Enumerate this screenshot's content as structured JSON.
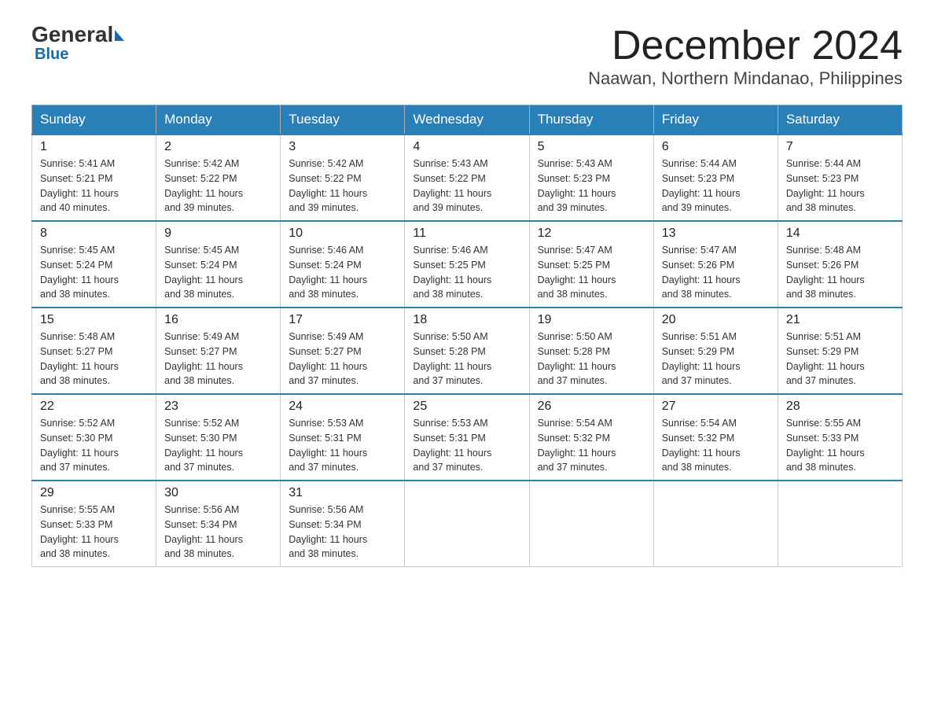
{
  "header": {
    "logo_general": "General",
    "logo_blue": "Blue",
    "month_title": "December 2024",
    "location": "Naawan, Northern Mindanao, Philippines"
  },
  "weekdays": [
    "Sunday",
    "Monday",
    "Tuesday",
    "Wednesday",
    "Thursday",
    "Friday",
    "Saturday"
  ],
  "weeks": [
    [
      {
        "day": "1",
        "sunrise": "5:41 AM",
        "sunset": "5:21 PM",
        "daylight": "11 hours and 40 minutes."
      },
      {
        "day": "2",
        "sunrise": "5:42 AM",
        "sunset": "5:22 PM",
        "daylight": "11 hours and 39 minutes."
      },
      {
        "day": "3",
        "sunrise": "5:42 AM",
        "sunset": "5:22 PM",
        "daylight": "11 hours and 39 minutes."
      },
      {
        "day": "4",
        "sunrise": "5:43 AM",
        "sunset": "5:22 PM",
        "daylight": "11 hours and 39 minutes."
      },
      {
        "day": "5",
        "sunrise": "5:43 AM",
        "sunset": "5:23 PM",
        "daylight": "11 hours and 39 minutes."
      },
      {
        "day": "6",
        "sunrise": "5:44 AM",
        "sunset": "5:23 PM",
        "daylight": "11 hours and 39 minutes."
      },
      {
        "day": "7",
        "sunrise": "5:44 AM",
        "sunset": "5:23 PM",
        "daylight": "11 hours and 38 minutes."
      }
    ],
    [
      {
        "day": "8",
        "sunrise": "5:45 AM",
        "sunset": "5:24 PM",
        "daylight": "11 hours and 38 minutes."
      },
      {
        "day": "9",
        "sunrise": "5:45 AM",
        "sunset": "5:24 PM",
        "daylight": "11 hours and 38 minutes."
      },
      {
        "day": "10",
        "sunrise": "5:46 AM",
        "sunset": "5:24 PM",
        "daylight": "11 hours and 38 minutes."
      },
      {
        "day": "11",
        "sunrise": "5:46 AM",
        "sunset": "5:25 PM",
        "daylight": "11 hours and 38 minutes."
      },
      {
        "day": "12",
        "sunrise": "5:47 AM",
        "sunset": "5:25 PM",
        "daylight": "11 hours and 38 minutes."
      },
      {
        "day": "13",
        "sunrise": "5:47 AM",
        "sunset": "5:26 PM",
        "daylight": "11 hours and 38 minutes."
      },
      {
        "day": "14",
        "sunrise": "5:48 AM",
        "sunset": "5:26 PM",
        "daylight": "11 hours and 38 minutes."
      }
    ],
    [
      {
        "day": "15",
        "sunrise": "5:48 AM",
        "sunset": "5:27 PM",
        "daylight": "11 hours and 38 minutes."
      },
      {
        "day": "16",
        "sunrise": "5:49 AM",
        "sunset": "5:27 PM",
        "daylight": "11 hours and 38 minutes."
      },
      {
        "day": "17",
        "sunrise": "5:49 AM",
        "sunset": "5:27 PM",
        "daylight": "11 hours and 37 minutes."
      },
      {
        "day": "18",
        "sunrise": "5:50 AM",
        "sunset": "5:28 PM",
        "daylight": "11 hours and 37 minutes."
      },
      {
        "day": "19",
        "sunrise": "5:50 AM",
        "sunset": "5:28 PM",
        "daylight": "11 hours and 37 minutes."
      },
      {
        "day": "20",
        "sunrise": "5:51 AM",
        "sunset": "5:29 PM",
        "daylight": "11 hours and 37 minutes."
      },
      {
        "day": "21",
        "sunrise": "5:51 AM",
        "sunset": "5:29 PM",
        "daylight": "11 hours and 37 minutes."
      }
    ],
    [
      {
        "day": "22",
        "sunrise": "5:52 AM",
        "sunset": "5:30 PM",
        "daylight": "11 hours and 37 minutes."
      },
      {
        "day": "23",
        "sunrise": "5:52 AM",
        "sunset": "5:30 PM",
        "daylight": "11 hours and 37 minutes."
      },
      {
        "day": "24",
        "sunrise": "5:53 AM",
        "sunset": "5:31 PM",
        "daylight": "11 hours and 37 minutes."
      },
      {
        "day": "25",
        "sunrise": "5:53 AM",
        "sunset": "5:31 PM",
        "daylight": "11 hours and 37 minutes."
      },
      {
        "day": "26",
        "sunrise": "5:54 AM",
        "sunset": "5:32 PM",
        "daylight": "11 hours and 37 minutes."
      },
      {
        "day": "27",
        "sunrise": "5:54 AM",
        "sunset": "5:32 PM",
        "daylight": "11 hours and 38 minutes."
      },
      {
        "day": "28",
        "sunrise": "5:55 AM",
        "sunset": "5:33 PM",
        "daylight": "11 hours and 38 minutes."
      }
    ],
    [
      {
        "day": "29",
        "sunrise": "5:55 AM",
        "sunset": "5:33 PM",
        "daylight": "11 hours and 38 minutes."
      },
      {
        "day": "30",
        "sunrise": "5:56 AM",
        "sunset": "5:34 PM",
        "daylight": "11 hours and 38 minutes."
      },
      {
        "day": "31",
        "sunrise": "5:56 AM",
        "sunset": "5:34 PM",
        "daylight": "11 hours and 38 minutes."
      },
      null,
      null,
      null,
      null
    ]
  ],
  "labels": {
    "sunrise": "Sunrise:",
    "sunset": "Sunset:",
    "daylight": "Daylight:"
  }
}
